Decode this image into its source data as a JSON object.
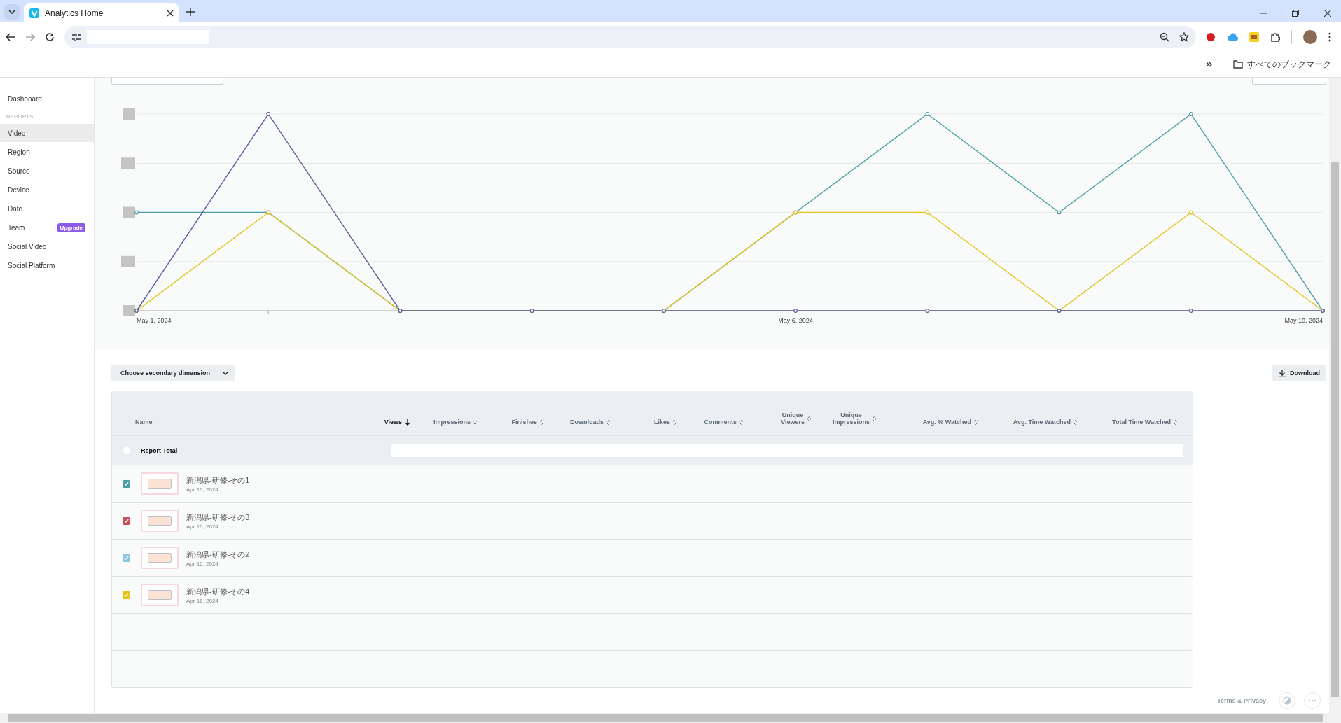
{
  "browser": {
    "tab_title": "Analytics Home",
    "bookmarks_label": "すべてのブックマーク"
  },
  "sidebar": {
    "items": [
      {
        "label": "Dashboard",
        "kind": "item",
        "selected": false
      },
      {
        "label": "REPORTS",
        "kind": "heading"
      },
      {
        "label": "Video",
        "kind": "item",
        "selected": true
      },
      {
        "label": "Region",
        "kind": "item",
        "selected": false
      },
      {
        "label": "Source",
        "kind": "item",
        "selected": false
      },
      {
        "label": "Device",
        "kind": "item",
        "selected": false
      },
      {
        "label": "Date",
        "kind": "item",
        "selected": false
      },
      {
        "label": "Team",
        "kind": "item",
        "selected": false,
        "badge": "Upgrade"
      },
      {
        "label": "Social Video",
        "kind": "item",
        "selected": false
      },
      {
        "label": "Social Platform",
        "kind": "item",
        "selected": false
      }
    ]
  },
  "chart": {
    "x_labels": [
      "May 1, 2024",
      "May 6, 2024",
      "May 10, 2024"
    ]
  },
  "controls": {
    "dimension_dropdown": "Choose secondary dimension",
    "download_button": "Download"
  },
  "table": {
    "columns": [
      {
        "lines": [
          "Name"
        ],
        "sorted": false
      },
      {
        "lines": [
          "Views"
        ],
        "sorted": true
      },
      {
        "lines": [
          "Impressions"
        ],
        "sorted": false
      },
      {
        "lines": [
          "Finishes"
        ],
        "sorted": false
      },
      {
        "lines": [
          "Downloads"
        ],
        "sorted": false
      },
      {
        "lines": [
          "Likes"
        ],
        "sorted": false
      },
      {
        "lines": [
          "Comments"
        ],
        "sorted": false
      },
      {
        "lines": [
          "Unique",
          "Viewers"
        ],
        "sorted": false
      },
      {
        "lines": [
          "Unique",
          "Impressions"
        ],
        "sorted": false
      },
      {
        "lines": [
          "Avg. % Watched"
        ],
        "sorted": false
      },
      {
        "lines": [
          "Avg. Time Watched"
        ],
        "sorted": false
      },
      {
        "lines": [
          "Total Time Watched"
        ],
        "sorted": false
      }
    ],
    "total_row": {
      "label": "Report Total",
      "checked": false
    },
    "rows": [
      {
        "title": "新潟県-研修-その1",
        "date": "Apr 16, 2024",
        "checked": true,
        "color": "#4a9fa5"
      },
      {
        "title": "新潟県-研修-その3",
        "date": "Apr 16, 2024",
        "checked": true,
        "color": "#c9505a"
      },
      {
        "title": "新潟県-研修-その2",
        "date": "Apr 16, 2024",
        "checked": true,
        "color": "#8cc3dd"
      },
      {
        "title": "新潟県-研修-その4",
        "date": "Apr 16, 2024",
        "checked": true,
        "color": "#e8c41a"
      }
    ]
  },
  "footer": {
    "link": "Terms & Privacy"
  }
}
